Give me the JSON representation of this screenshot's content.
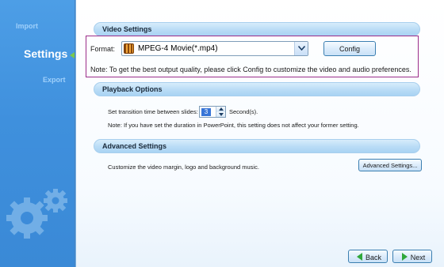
{
  "sidebar": {
    "items": [
      {
        "label": "Import",
        "active": false
      },
      {
        "label": "Settings",
        "active": true
      },
      {
        "label": "Export",
        "active": false
      }
    ],
    "accent": "#7cc94a"
  },
  "video_settings": {
    "title": "Video Settings",
    "format_label": "Format:",
    "format_value": "MPEG-4 Movie(*.mp4)",
    "format_icon": "film-icon",
    "config_label": "Config",
    "note": "Note: To get the best output quality, please click Config to customize the video and audio preferences."
  },
  "playback_options": {
    "title": "Playback Options",
    "transition_label": "Set transition time between slides:",
    "transition_value": "3",
    "seconds_label": "Second(s).",
    "note": "Note: If you have set the duration in PowerPoint, this setting does not affect your former setting."
  },
  "advanced_settings": {
    "title": "Advanced Settings",
    "description": "Customize the video margin, logo and background music.",
    "button_label": "Advanced Settings..."
  },
  "navigation": {
    "back_label": "Back",
    "next_label": "Next"
  },
  "colors": {
    "sidebar_bg": "#3f90dd",
    "highlight_border": "#9b2d8a",
    "nav_icon": "#2fa83a"
  }
}
